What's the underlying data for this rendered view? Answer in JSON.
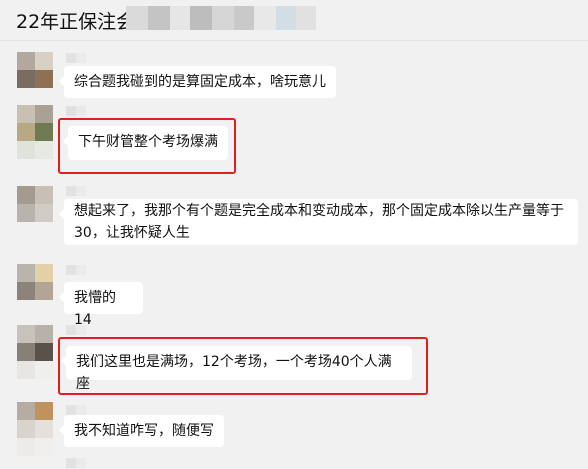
{
  "chat": {
    "title": "22年正保注会",
    "messages": [
      {
        "text": "综合题我碰到的是算固定成本，啥玩意儿",
        "highlighted": false
      },
      {
        "text": "下午财管整个考场爆满",
        "highlighted": true
      },
      {
        "text": "想起来了，我那个有个题是完全成本和变动成本，那个固定成本除以生产量等于30，让我怀疑人生",
        "highlighted": false
      },
      {
        "text": "我懵的14",
        "highlighted": false
      },
      {
        "text": "我们这里也是满场，12个考场，一个考场40个人满座",
        "highlighted": true
      },
      {
        "text": "我不知道咋写，随便写",
        "highlighted": false
      }
    ]
  },
  "colors": {
    "background": "#f1f1f1",
    "bubble": "#ffffff",
    "highlight_border": "#e02020"
  }
}
